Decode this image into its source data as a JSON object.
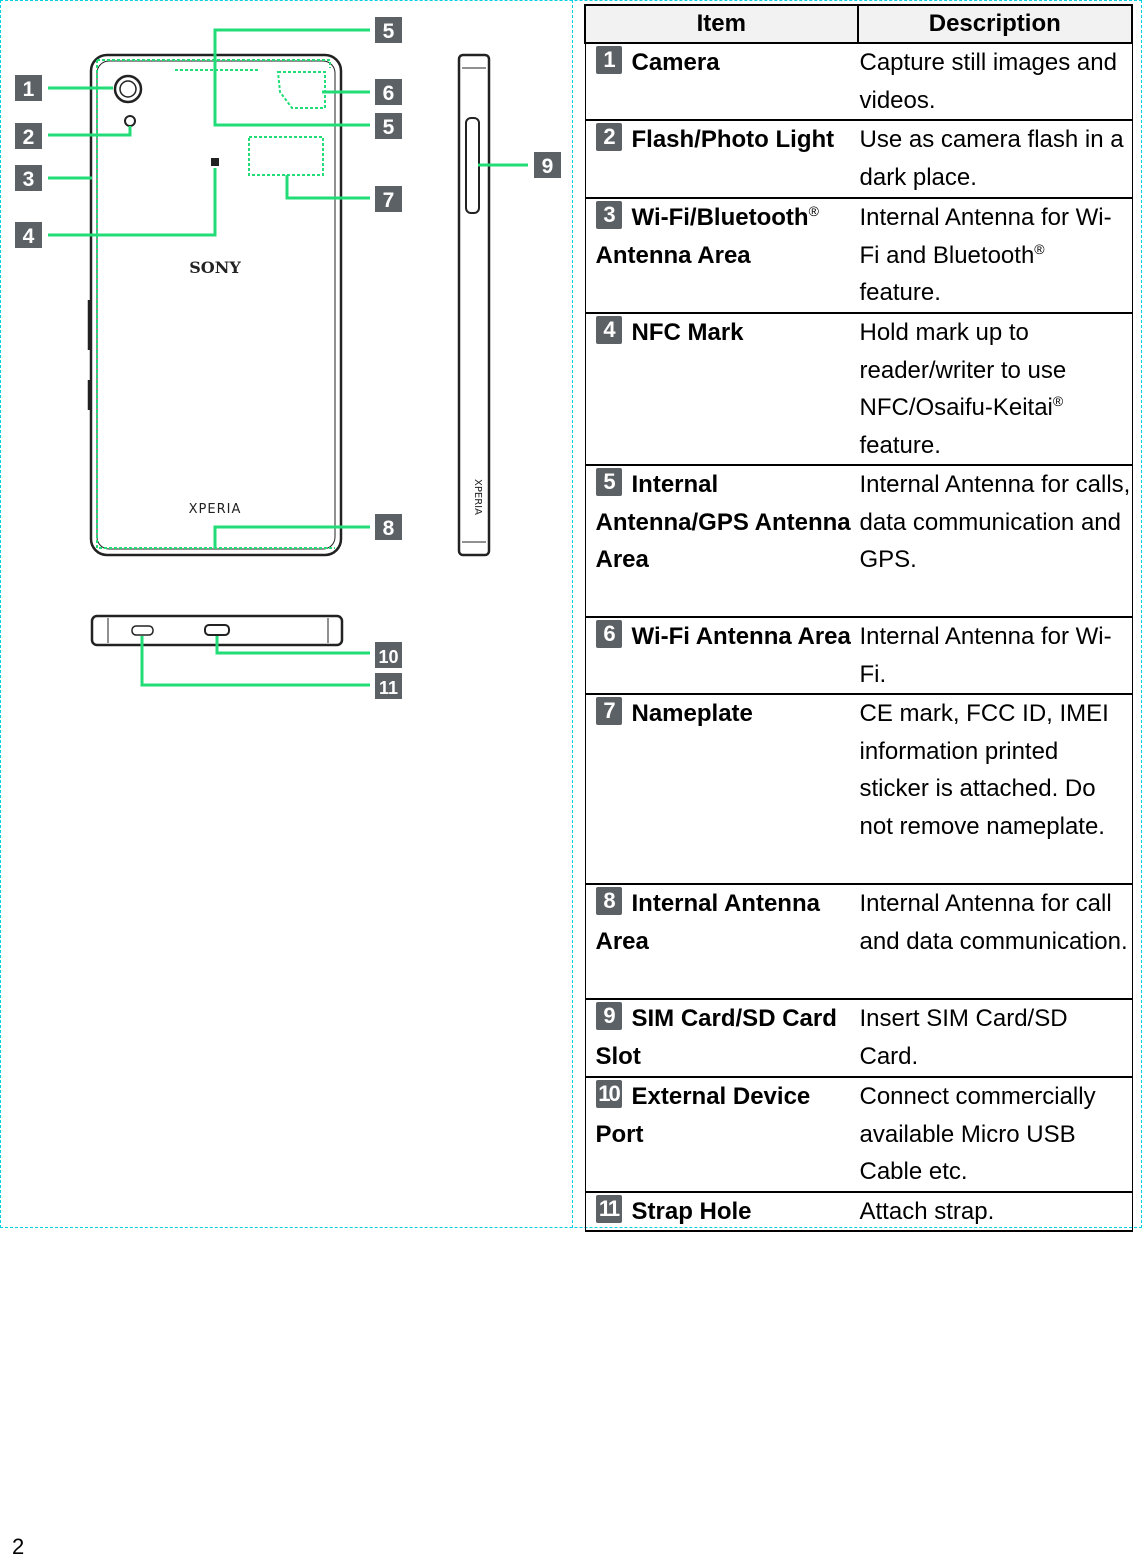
{
  "diagram": {
    "labels": [
      "1",
      "2",
      "3",
      "4",
      "5",
      "6",
      "5",
      "7",
      "8",
      "9",
      "10",
      "11"
    ],
    "brand": "SONY",
    "model": "XPERIA",
    "accent_color": "#22dd77",
    "label_color": "#5c6166"
  },
  "table": {
    "headers": {
      "item": "Item",
      "description": "Description"
    },
    "rows": [
      {
        "num": "1",
        "item": "Camera",
        "item_sup": "",
        "item2": "",
        "desc": "Capture still images and videos.",
        "desc_sup": "",
        "desc2": ""
      },
      {
        "num": "2",
        "item": "Flash/Photo Light",
        "item_sup": "",
        "item2": "",
        "desc": "Use as camera flash in a dark place.",
        "desc_sup": "",
        "desc2": ""
      },
      {
        "num": "3",
        "item": "Wi-Fi/Bluetooth",
        "item_sup": "®",
        "item2": " Antenna Area",
        "desc": "Internal Antenna for Wi-Fi and Bluetooth",
        "desc_sup": "®",
        "desc2": " feature."
      },
      {
        "num": "4",
        "item": "NFC Mark",
        "item_sup": "",
        "item2": "",
        "desc": "Hold mark up to reader/writer to use NFC/Osaifu-Keitai",
        "desc_sup": "®",
        "desc2": " feature."
      },
      {
        "num": "5",
        "item": "Internal Antenna/GPS Antenna Area",
        "item_sup": "",
        "item2": "",
        "desc": "Internal Antenna for calls, data communication and GPS.",
        "desc_sup": "",
        "desc2": ""
      },
      {
        "num": "6",
        "item": "Wi-Fi Antenna Area",
        "item_sup": "",
        "item2": "",
        "desc": "Internal Antenna for Wi-Fi.",
        "desc_sup": "",
        "desc2": ""
      },
      {
        "num": "7",
        "item": "Nameplate",
        "item_sup": "",
        "item2": "",
        "desc": "CE mark, FCC ID, IMEI information printed sticker is attached. Do not remove nameplate.",
        "desc_sup": "",
        "desc2": ""
      },
      {
        "num": "8",
        "item": "Internal Antenna Area",
        "item_sup": "",
        "item2": "",
        "desc": "Internal Antenna for call and data communication.",
        "desc_sup": "",
        "desc2": ""
      },
      {
        "num": "9",
        "item": "SIM Card/SD Card Slot",
        "item_sup": "",
        "item2": "",
        "desc": "Insert SIM Card/SD Card.",
        "desc_sup": "",
        "desc2": ""
      },
      {
        "num": "10",
        "item": "External Device Port",
        "item_sup": "",
        "item2": "",
        "desc": "Connect commercially available Micro USB Cable etc.",
        "desc_sup": "",
        "desc2": ""
      },
      {
        "num": "11",
        "item": "Strap Hole",
        "item_sup": "",
        "item2": "",
        "desc": "Attach strap.",
        "desc_sup": "",
        "desc2": ""
      }
    ]
  },
  "page_number": "2"
}
